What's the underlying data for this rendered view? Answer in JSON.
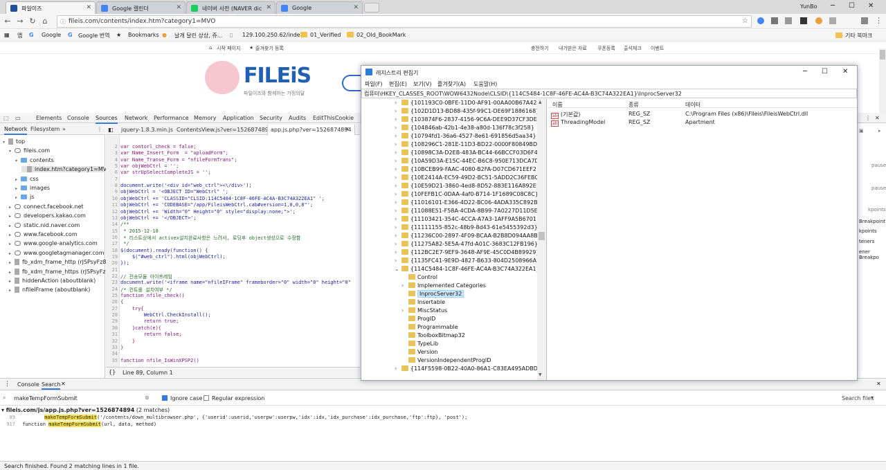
{
  "browser": {
    "tabs": [
      {
        "title": "파일이즈",
        "favicon_color": "#1f4e9b"
      },
      {
        "title": "Google 캘린더",
        "favicon_color": "#4285f4"
      },
      {
        "title": "네이버 사전 (NAVER dic",
        "favicon_color": "#19ce60"
      },
      {
        "title": "Google",
        "favicon_color": "#4285f4"
      }
    ],
    "user_label": "YunBo",
    "url": "fileis.com/contents/index.htm?category1=MVO",
    "bookmarks": [
      "앱",
      "Google",
      "Google 번역",
      "Bookmarks",
      "날개 달린 상상, 쥬...",
      "129.100.250.62/inde",
      "01_Verified",
      "02_Old_BookMark"
    ],
    "other_bookmarks": "기타 북마크"
  },
  "site": {
    "topnav_left": [
      "시작 페이지",
      "즐겨찾기 등록"
    ],
    "topnav_right": [
      "충전하기",
      "내가받은 자료",
      "쿠폰등록",
      "출석체크",
      "이벤트"
    ],
    "logo_text": "FILEiS",
    "logo_sub": "파일이즈와 함께하는 가정의달"
  },
  "devtools": {
    "tabs": [
      "Elements",
      "Console",
      "Sources",
      "Network",
      "Performance",
      "Memory",
      "Application",
      "Security",
      "Audits",
      "EditThisCookie"
    ],
    "active_tab": "Sources",
    "nav_tabs": [
      "Network",
      "Filesystem"
    ],
    "tree": [
      {
        "label": "top",
        "indent": 0,
        "icon": "doc",
        "tri": "▾"
      },
      {
        "label": "fileis.com",
        "indent": 1,
        "icon": "cloud",
        "tri": "▾"
      },
      {
        "label": "contents",
        "indent": 2,
        "icon": "fold",
        "tri": "▾"
      },
      {
        "label": "index.htm?category1=MVO",
        "indent": 3,
        "icon": "doc",
        "tri": ""
      },
      {
        "label": "css",
        "indent": 2,
        "icon": "fold",
        "tri": "▸"
      },
      {
        "label": "images",
        "indent": 2,
        "icon": "fold",
        "tri": "▸"
      },
      {
        "label": "js",
        "indent": 2,
        "icon": "fold",
        "tri": "▸"
      },
      {
        "label": "connect.facebook.net",
        "indent": 1,
        "icon": "cloud",
        "tri": "▸"
      },
      {
        "label": "developers.kakao.com",
        "indent": 1,
        "icon": "cloud",
        "tri": "▸"
      },
      {
        "label": "static.nid.naver.com",
        "indent": 1,
        "icon": "cloud",
        "tri": "▸"
      },
      {
        "label": "www.facebook.com",
        "indent": 1,
        "icon": "cloud",
        "tri": "▸"
      },
      {
        "label": "www.google-analytics.com",
        "indent": 1,
        "icon": "cloud",
        "tri": "▸"
      },
      {
        "label": "www.googletagmanager.com",
        "indent": 1,
        "icon": "cloud",
        "tri": "▸"
      },
      {
        "label": "fb_xdm_frame_http (rJSPsyFz8kQ",
        "indent": 1,
        "icon": "doc",
        "tri": "▸"
      },
      {
        "label": "fb_xdm_frame_https (rJSPsyFz8kQ",
        "indent": 1,
        "icon": "doc",
        "tri": "▸"
      },
      {
        "label": "hiddenAction (aboutblank)",
        "indent": 1,
        "icon": "doc",
        "tri": "▸"
      },
      {
        "label": "nfileIFrame (aboutblank)",
        "indent": 1,
        "icon": "doc",
        "tri": "▸"
      }
    ],
    "file_tabs": [
      "jquery-1.8.3.min.js",
      "ContentsView.js?ver=1526874894",
      "app.js.php?ver=1526874894"
    ],
    "active_file": "app.js.php?ver=1526874894",
    "code_lines": [
      {
        "n": "2",
        "t": "var contorl_check = false;",
        "k": "p"
      },
      {
        "n": "3",
        "t": "var Name_Insert_Form  = \"uploadForm\";",
        "k": "p"
      },
      {
        "n": "4",
        "t": "var Name_Transe_Form = \"nfileFormTrans\";",
        "k": "p"
      },
      {
        "n": "5",
        "t": "var objWebCtrl = '';",
        "k": "p"
      },
      {
        "n": "6",
        "t": "var strUpSelectCompleteJS = '';",
        "k": "p"
      },
      {
        "n": "7",
        "t": "",
        "k": "p"
      },
      {
        "n": "8",
        "t": "document.write('<div id=\"web_ctrl\"><\\/div>');",
        "k": "b"
      },
      {
        "n": "9",
        "t": "objWebCtrl = '<OBJECT ID=\"WebCtrl\" ';",
        "k": "b"
      },
      {
        "n": "10",
        "t": "objWebCtrl += 'CLASSID=\"CLSID:114C5484-1C8F-46FE-AC4A-B3C74A322EA1\" ';",
        "k": "b"
      },
      {
        "n": "11",
        "t": "objWebCtrl += 'CODEBASE=\"/app/FileisWebCtrl.cab#version=1,0,0,8\"';",
        "k": "b"
      },
      {
        "n": "12",
        "t": "objWebCtrl += 'Width=\"0\" Height=\"0\" style=\"display:none;\">';",
        "k": "b"
      },
      {
        "n": "13",
        "t": "objWebCtrl += '</OBJECT>';",
        "k": "b"
      },
      {
        "n": "14",
        "t": "/**",
        "k": "c"
      },
      {
        "n": "15",
        "t": " * 2015-12-18",
        "k": "c"
      },
      {
        "n": "16",
        "t": " * 리스트상에서 activex설치완료사항은 느려서, 로딩후 object생성으로 수정함",
        "k": "c"
      },
      {
        "n": "17",
        "t": " */",
        "k": "c"
      },
      {
        "n": "18",
        "t": "$(document).ready(function() {",
        "k": "b"
      },
      {
        "n": "19",
        "t": "    $(\"#web_ctrl\").html(objWebCtrl);",
        "k": "b"
      },
      {
        "n": "20",
        "t": "});",
        "k": "b"
      },
      {
        "n": "21",
        "t": "",
        "k": "p"
      },
      {
        "n": "22",
        "t": "// 전송모듈 아이프레임",
        "k": "c"
      },
      {
        "n": "23",
        "t": "document.write('<iframe name=\"nfileIFrame\" frameborder=\"0\" width=\"0\" height=\"0\"",
        "k": "b"
      },
      {
        "n": "24",
        "t": "/* 컨트롤 설치여부 */",
        "k": "c"
      },
      {
        "n": "25",
        "t": "function nfile_check()",
        "k": "p"
      },
      {
        "n": "26",
        "t": "{",
        "k": "p"
      },
      {
        "n": "27",
        "t": "    try{",
        "k": "p"
      },
      {
        "n": "28",
        "t": "        WebCtrl.CheckInstall();",
        "k": "b"
      },
      {
        "n": "29",
        "t": "        return true;",
        "k": "p"
      },
      {
        "n": "30",
        "t": "    }catch(e){",
        "k": "p"
      },
      {
        "n": "31",
        "t": "        return false;",
        "k": "p"
      },
      {
        "n": "32",
        "t": "    }",
        "k": "p"
      },
      {
        "n": "33",
        "t": "}",
        "k": "p"
      },
      {
        "n": "34",
        "t": "",
        "k": "p"
      },
      {
        "n": "35",
        "t": "function nfile_IsWinXPSP2()",
        "k": "p"
      }
    ],
    "cursor_status": "Line 89, Column 1",
    "right_pane": [
      "paused",
      "paused",
      "kpoints",
      "Breakpoint",
      "kpoints",
      "teners",
      "ener Breakpo"
    ],
    "drawer_tabs": [
      "Console",
      "Search"
    ],
    "search_query": "makeTempFormSubmit",
    "ignore_case_label": "Ignore case",
    "regex_label": "Regular expression",
    "search_files_label": "Search files",
    "result_file": "fileis.com/js/app.js.php?ver=1526874894",
    "result_count": "(2 matches)",
    "results": [
      {
        "line": "89",
        "pre": "",
        "match": "makeTempFormSubmit",
        "post": "('/contents/down_multibrowser.php', {'userid':userid,'userpw':userpw,'idx':idx,'idx_purchase':idx_purchase,'ftp':ftp}, 'post');"
      },
      {
        "line": "917",
        "pre": "function ",
        "match": "makeTempFormSubmit",
        "post": "(url, data, method)"
      }
    ],
    "status_text": "Search finished.  Found 2 matching lines in 1 file."
  },
  "regedit": {
    "title": "레지스트리 편집기",
    "menu": [
      "파일(F)",
      "편집(E)",
      "보기(V)",
      "즐겨찾기(A)",
      "도움말(H)"
    ],
    "address": "컴퓨터\\HKEY_CLASSES_ROOT\\WOW6432Node\\CLSID\\{114C5484-1C8F-46FE-AC4A-B3C74A322EA1}\\InprocServer32",
    "keys": [
      "{101193C0-0BFE-11D0-AF91-00AA00B67A42}",
      "{102D1D13-BD88-435f-99C1-DE69F1886168}",
      "{103874F6-2837-4156-9C6A-DEE9D37CF3DE}",
      "{104846ab-42b1-4e38-a80d-136f78c3f258}",
      "{10794fd1-36a6-4527-8e61-691856d5aa34}",
      "{108296C1-281E-11D3-BD22-0000F80849BD}",
      "{10898C3A-D2EB-483A-BC44-66BCCF03D6F4}",
      "{10A59D3A-E15C-44EC-B6C8-950E713DCA7D}",
      "{10BCEB99-FAAC-4080-B2FA-D07CD671EEF2}",
      "{10E2414A-EC59-49D2-BC51-5ADD2C36FEBC}",
      "{10E59D21-3860-4ed8-8D52-883E116A892E}",
      "{10FEFB1C-0DAA-4af0-B714-1F1689C08C8C}",
      "{11016101-E366-4D22-BC06-4ADA335C892B}",
      "{11088E51-F58A-4CDA-8B99-7A0227D11D5E}",
      "{11103421-354C-4CCA-A7A3-1AFF9A5B6701}",
      "{11111155-852c-48b9-8d43-61e5455392d3}",
      "{11236C00-2897-4F09-BCAA-B2B8D094AA8B}",
      "{11275A82-5E5A-47fd-A01C-3683C12FB196}",
      "{112BC2E7-9EF9-3648-AF9E-45C0D4B89929}",
      "{1135FC41-9E9D-4827-B633-804D2508966A}",
      "{114C5484-1C8F-46FE-AC4A-B3C74A322EA1}"
    ],
    "subkeys": [
      "Control",
      "Implemented Categories",
      "InprocServer32",
      "Insertable",
      "MiscStatus",
      "ProgID",
      "Programmable",
      "ToolboxBitmap32",
      "TypeLib",
      "Version",
      "VersionIndependentProgID"
    ],
    "selected_subkey": "InprocServer32",
    "last_key": "{114F5598-0B22-40A0-86A1-C83EA495ADBD}",
    "columns": [
      "이름",
      "종류",
      "데이터"
    ],
    "values": [
      {
        "name": "(기본값)",
        "type": "REG_SZ",
        "data": "C:\\Program Files (x86)\\Fileis\\FileisWebCtrl.dll"
      },
      {
        "name": "ThreadingModel",
        "type": "REG_SZ",
        "data": "Apartment"
      }
    ]
  }
}
